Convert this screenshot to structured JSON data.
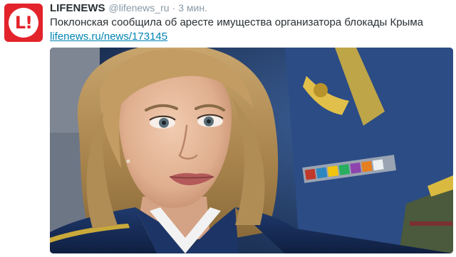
{
  "tweet": {
    "display_name": "LIFENEWS",
    "handle": "@lifenews_ru",
    "separator": "·",
    "time": "3 мин.",
    "text": "Поклонская сообщила об аресте имущества организатора блокады Крыма",
    "link": "lifenews.ru/news/173145"
  },
  "avatar": {
    "glyph": "L!",
    "brand_color": "#e3232b"
  },
  "colors": {
    "link": "#0084b4",
    "meta": "#8899a6",
    "text": "#292f33"
  }
}
